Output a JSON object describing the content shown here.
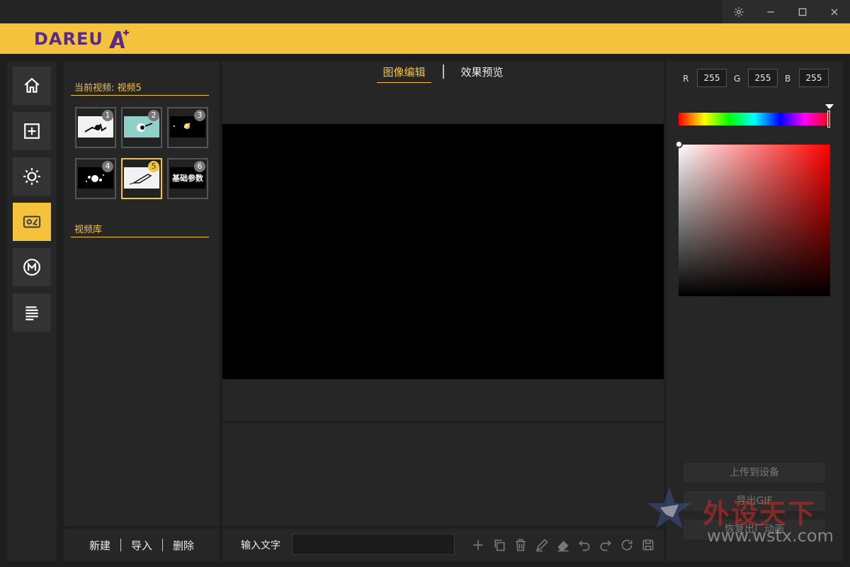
{
  "brand": {
    "name": "DAREU",
    "mark_letter": "A"
  },
  "window_controls": {
    "settings_icon": "gear-icon",
    "minimize_icon": "minimize-icon",
    "maximize_icon": "maximize-icon",
    "close_icon": "close-icon"
  },
  "nav": {
    "items": [
      {
        "icon": "home-icon",
        "active": false
      },
      {
        "icon": "add-square-icon",
        "active": false
      },
      {
        "icon": "sun-icon",
        "active": false
      },
      {
        "icon": "screen-icon",
        "active": true
      },
      {
        "icon": "macro-m-icon",
        "active": false
      },
      {
        "icon": "list-icon",
        "active": false
      }
    ]
  },
  "video_panel": {
    "current_title": "当前视频: 视频5",
    "library_title": "视频库",
    "thumbnails": [
      {
        "num": "1",
        "bg": "#f2f2f2"
      },
      {
        "num": "2",
        "bg": "#8fd0c8"
      },
      {
        "num": "3",
        "bg": "#000000"
      },
      {
        "num": "4",
        "bg": "#000000"
      },
      {
        "num": "5",
        "bg": "#f2f2f2"
      },
      {
        "num": "6",
        "bg": "#000000",
        "label": "基础参数"
      }
    ],
    "actions": {
      "new": "新建",
      "import": "导入",
      "delete": "删除"
    }
  },
  "editor": {
    "tabs": {
      "edit": "图像编辑",
      "preview": "效果预览"
    },
    "text_input_label": "输入文字",
    "text_input_value": ""
  },
  "color_panel": {
    "r_label": "R",
    "r_value": "255",
    "g_label": "G",
    "g_value": "255",
    "b_label": "B",
    "b_value": "255",
    "upload_button": "上传到设备",
    "save_button": "导出GIF",
    "reset_button": "恢复出厂动画"
  },
  "watermark": {
    "cn": "外设天下",
    "url": "www.wstx.com"
  },
  "colors": {
    "accent": "#f5c33b",
    "brand": "#5b2a86",
    "panel": "#262626"
  }
}
